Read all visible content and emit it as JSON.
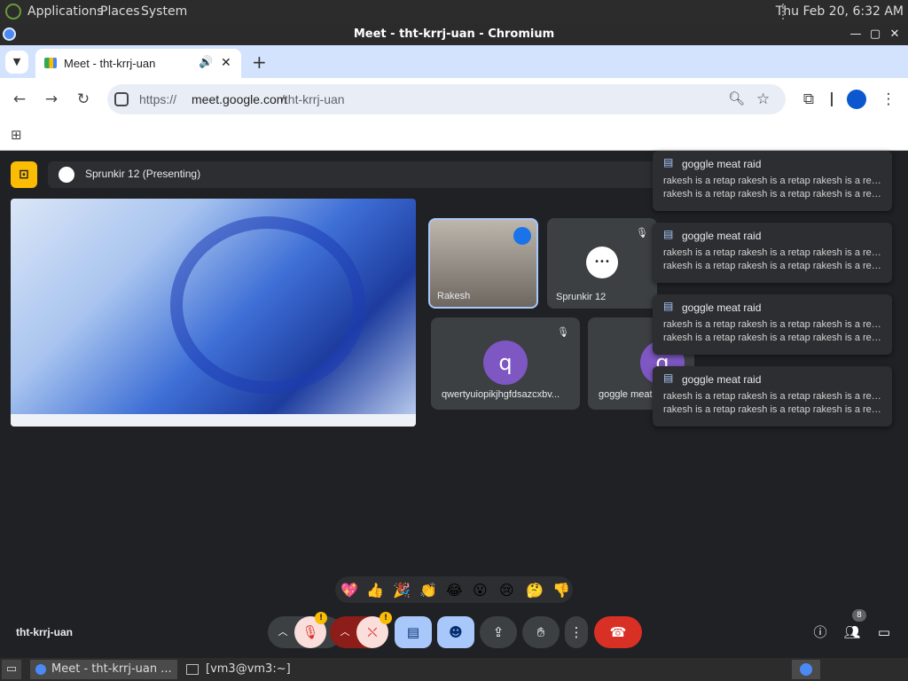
{
  "panel": {
    "menu_applications": "Applications",
    "menu_places": "Places",
    "menu_system": "System",
    "clock": "Thu Feb 20,  6:32 AM"
  },
  "window": {
    "title": "Meet - tht-krrj-uan - Chromium"
  },
  "tab": {
    "title": "Meet - tht-krrj-uan"
  },
  "omnibox": {
    "scheme": "https://",
    "host": "meet.google.com",
    "path": "/tht-krrj-uan"
  },
  "meet": {
    "presenting_label": "Sprunkir 12 (Presenting)",
    "meeting_code": "tht-krrj-uan",
    "participant_count": "8",
    "tiles": [
      {
        "name": "Rakesh",
        "avatar": ""
      },
      {
        "name": "Sprunkir 12",
        "avatar": "•••"
      },
      {
        "name": "qwertyuiopikjhgfdsazcxbv...",
        "avatar": "q"
      },
      {
        "name": "goggle meat",
        "avatar": "g"
      }
    ],
    "notifications": [
      {
        "title": "goggle meat raid",
        "line1": "rakesh is a retap rakesh is a retap rakesh is a retap",
        "line2": "rakesh is a retap rakesh is a retap rakesh is a reta..."
      },
      {
        "title": "goggle meat raid",
        "line1": "rakesh is a retap rakesh is a retap rakesh is a retap",
        "line2": "rakesh is a retap rakesh is a retap rakesh is a reta..."
      },
      {
        "title": "goggle meat raid",
        "line1": "rakesh is a retap rakesh is a retap rakesh is a retap",
        "line2": "rakesh is a retap rakesh is a retap rakesh is a reta..."
      },
      {
        "title": "goggle meat raid",
        "line1": "rakesh is a retap rakesh is a retap rakesh is a retap",
        "line2": "rakesh is a retap rakesh is a retap rakesh is a reta..."
      }
    ],
    "reactions": [
      "💖",
      "👍",
      "🎉",
      "👏",
      "😂",
      "😮",
      "😢",
      "🤔",
      "👎"
    ]
  },
  "taskbar": {
    "task_meet": "Meet - tht-krrj-uan ...",
    "task_terminal": "[vm3@vm3:~]"
  },
  "colors": {
    "panel_bg": "#2c2c2c",
    "tabstrip_bg": "#d3e3fd",
    "meet_bg": "#202124",
    "end_call": "#d93025",
    "accent_blue": "#a8c7fa"
  }
}
